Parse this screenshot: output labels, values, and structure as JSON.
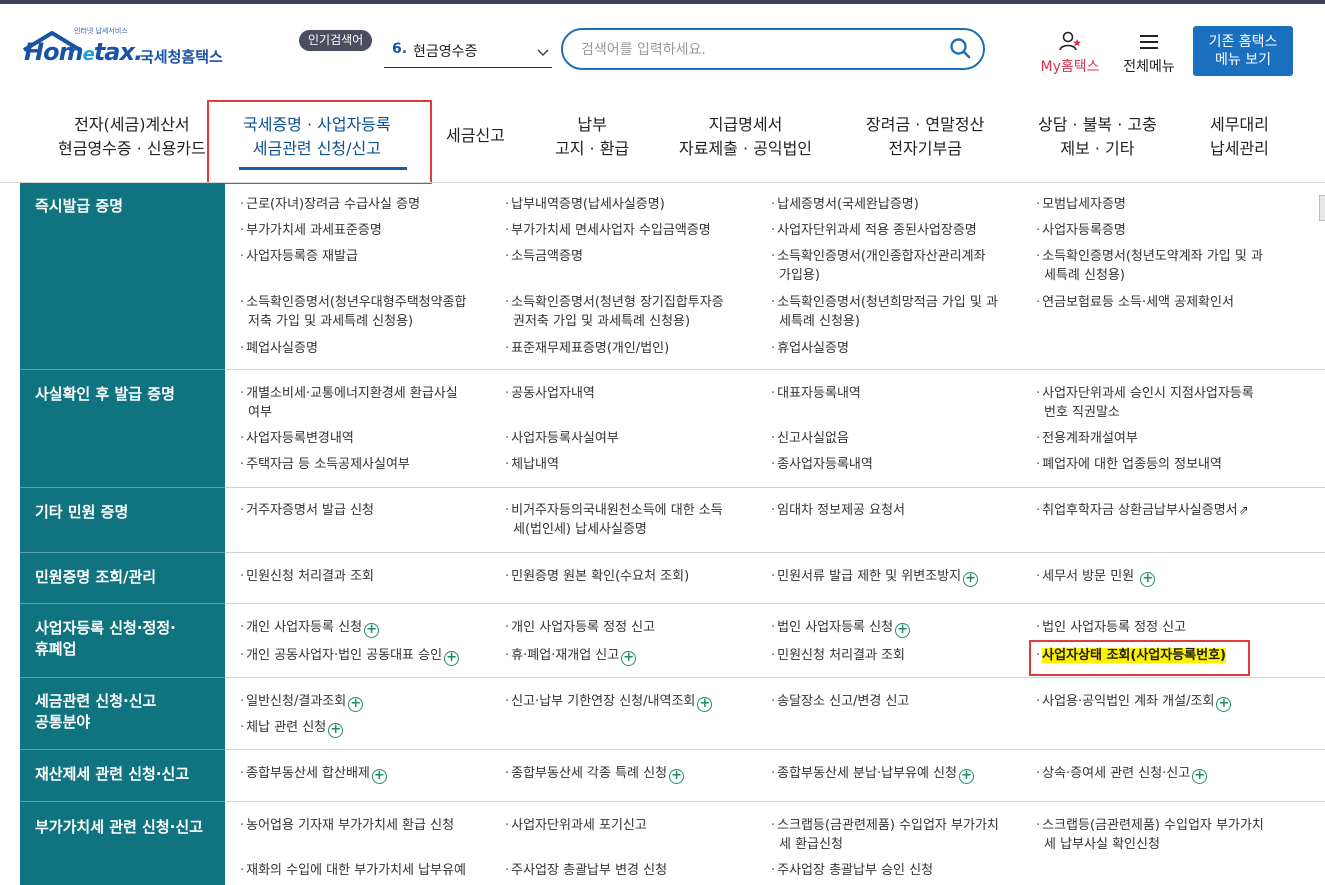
{
  "header": {
    "logo_sub": "인터넷 납세서비스",
    "logo_main_pre": "Hom",
    "logo_main_e": "e",
    "logo_main_post": "tax.",
    "logo_kr": "국세청홈택스",
    "popular_label": "인기검색어",
    "popular_rank": "6.",
    "popular_term": "현금영수증",
    "search_placeholder": "검색어를 입력하세요.",
    "my_label": "My홈택스",
    "menu_label": "전체메뉴",
    "old_menu_line1": "기존 홈택스",
    "old_menu_line2": "메뉴 보기"
  },
  "gnb": [
    {
      "line1": "전자(세금)계산서",
      "line2": "현금영수증 · 신용카드"
    },
    {
      "line1": "국세증명 · 사업자등록",
      "line2": "세금관련 신청/신고"
    },
    {
      "line1": "세금신고",
      "line2": ""
    },
    {
      "line1": "납부",
      "line2": "고지 · 환급"
    },
    {
      "line1": "지급명세서",
      "line2": "자료제출 · 공익법인"
    },
    {
      "line1": "장려금 · 연말정산",
      "line2": "전자기부금"
    },
    {
      "line1": "상담 · 불복 · 고충",
      "line2": "제보 · 기타"
    },
    {
      "line1": "세무대리",
      "line2": "납세관리"
    }
  ],
  "categories": [
    {
      "line1": "즉시발급 증명",
      "line2": ""
    },
    {
      "line1": "사실확인 후 발급 증명",
      "line2": ""
    },
    {
      "line1": "기타 민원 증명",
      "line2": ""
    },
    {
      "line1": "민원증명 조회/관리",
      "line2": ""
    },
    {
      "line1": "사업자등록 신청·정정·",
      "line2": "휴폐업"
    },
    {
      "line1": "세금관련 신청·신고",
      "line2": "공통분야"
    },
    {
      "line1": "재산제세 관련 신청·신고",
      "line2": ""
    },
    {
      "line1": "부가가치세 관련 신청·신고",
      "line2": ""
    }
  ],
  "items": {
    "r1": [
      "근로(자녀)장려금 수급사실 증명",
      "납부내역증명(납세사실증명)",
      "납세증명서(국세완납증명)",
      "모범납세자증명",
      "부가가치세 과세표준증명",
      "부가가치세 면세사업자 수입금액증명",
      "사업자단위과세 적용 종된사업장증명",
      "사업자등록증명",
      "사업자등록증 재발급",
      "소득금액증명",
      "소득확인증명서(개인종합자산관리계좌",
      "가입용)",
      "소득확인증명서(청년도약계좌 가입 및 과",
      "세특례 신청용)",
      "소득확인증명서(청년우대형주택청약종합",
      "저축 가입 및 과세특례 신청용)",
      "소득확인증명서(청년형 장기집합투자증",
      "권저축 가입 및 과세특례 신청용)",
      "소득확인증명서(청년희망적금 가입 및 과",
      "세특례 신청용)",
      "연금보험료등 소득·세액 공제확인서",
      "폐업사실증명",
      "표준재무제표증명(개인/법인)",
      "휴업사실증명"
    ],
    "r2": [
      "개별소비세·교통에너지환경세 환급사실",
      "여부",
      "공동사업자내역",
      "대표자등록내역",
      "사업자단위과세 승인시 지점사업자등록",
      "번호 직권말소",
      "사업자등록변경내역",
      "사업자등록사실여부",
      "신고사실없음",
      "전용계좌개설여부",
      "주택자금 등 소득공제사실여부",
      "체납내역",
      "종사업자등록내역",
      "폐업자에 대한 업종등의 정보내역"
    ],
    "r3": [
      "거주자증명서 발급 신청",
      "비거주자등의국내원천소득에 대한 소득",
      "세(법인세) 납세사실증명",
      "임대차 정보제공 요청서",
      "취업후학자금 상환금납부사실증명서"
    ],
    "r4": [
      "민원신청 처리결과 조회",
      "민원증명 원본 확인(수요처 조회)",
      "민원서류 발급 제한 및 위변조방지",
      "세무서 방문 민원"
    ],
    "r5": [
      "개인 사업자등록 신청",
      "개인 사업자등록 정정 신고",
      "법인 사업자등록 신청",
      "법인 사업자등록 정정 신고",
      "개인 공동사업자·법인 공동대표 승인",
      "휴·폐업·재개업 신고",
      "민원신청 처리결과 조회",
      "사업자상태 조회(사업자등록번호)"
    ],
    "r6": [
      "일반신청/결과조회",
      "신고·납부 기한연장 신청/내역조회",
      "송달장소 신고/변경 신고",
      "사업용·공익법인 계좌 개설/조회",
      "체납 관련 신청"
    ],
    "r7": [
      "종합부동산세 합산배제",
      "종합부동산세 각종 특례 신청",
      "종합부동산세 분납·납부유예 신청",
      "상속·증여세 관련 신청·신고"
    ],
    "r8": [
      "농어업용 기자재 부가가치세 환급 신청",
      "사업자단위과세 포기신고",
      "스크랩등(금관련제품) 수입업자 부가가치",
      "세 환급신청",
      "스크랩등(금관련제품) 수입업자 부가가치",
      "세 납부사실 확인신청",
      "재화의 수입에 대한 부가가치세 납부유예",
      "주사업장 총괄납부 변경 신청",
      "주사업장 총괄납부 승인 신청"
    ]
  },
  "icons": {
    "bullet": "·",
    "plus": "+",
    "external": "⇗"
  },
  "colors": {
    "brand": "#1a53a6",
    "category_bg": "#0f7480",
    "highlight": "#fff200",
    "red_box": "#e23b3b",
    "my_label": "#d3354f"
  }
}
